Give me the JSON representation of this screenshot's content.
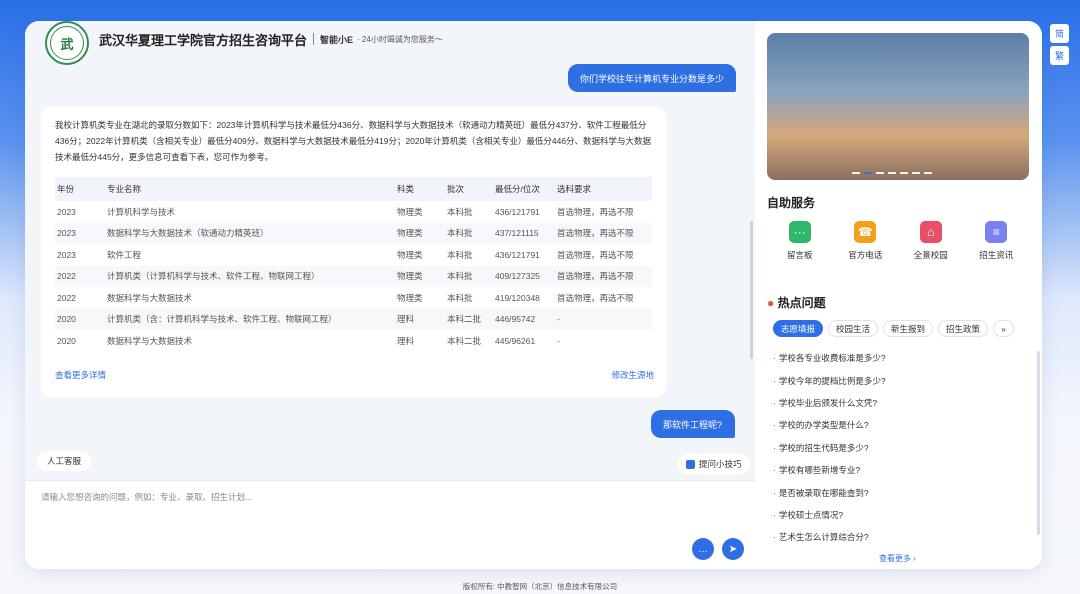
{
  "header": {
    "logo_text": "武",
    "title": "武汉华夏理工学院官方招生咨询平台",
    "assistant_name": "智能小E",
    "slogan": "· 24小时竭诚为您服务～"
  },
  "chat": {
    "user_msg_1": "你们学校往年计算机专业分数是多少",
    "answer_text": "我校计算机类专业在湖北的录取分数如下：2023年计算机科学与技术最低分436分、数据科学与大数据技术（软通动力精英班）最低分437分、软件工程最低分436分；2022年计算机类（含相关专业）最低分409分、数据科学与大数据技术最低分419分；2020年计算机类（含相关专业）最低分446分、数据科学与大数据技术最低分445分，更多信息可查看下表，您可作为参考。",
    "table_headers": [
      "年份",
      "专业名称",
      "科类",
      "批次",
      "最低分/位次",
      "选科要求"
    ],
    "table_rows": [
      [
        "2023",
        "计算机科学与技术",
        "物理类",
        "本科批",
        "436/121791",
        "首选物理，再选不限"
      ],
      [
        "2023",
        "数据科学与大数据技术（软通动力精英班）",
        "物理类",
        "本科批",
        "437/121115",
        "首选物理，再选不限"
      ],
      [
        "2023",
        "软件工程",
        "物理类",
        "本科批",
        "436/121791",
        "首选物理，再选不限"
      ],
      [
        "2022",
        "计算机类（计算机科学与技术、软件工程、物联网工程）",
        "物理类",
        "本科批",
        "409/127325",
        "首选物理，再选不限"
      ],
      [
        "2022",
        "数据科学与大数据技术",
        "物理类",
        "本科批",
        "419/120348",
        "首选物理，再选不限"
      ],
      [
        "2020",
        "计算机类（含：计算机科学与技术、软件工程、物联网工程）",
        "理科",
        "本科二批",
        "446/95742",
        "-"
      ],
      [
        "2020",
        "数据科学与大数据技术",
        "理科",
        "本科二批",
        "445/96261",
        "-"
      ]
    ],
    "link_more": "查看更多详情",
    "link_change_origin": "修改生源地",
    "user_msg_2": "那软件工程呢?"
  },
  "input": {
    "human_service": "人工客服",
    "tips": "提问小技巧",
    "placeholder": "请输入您想咨询的问题，例如：专业、录取、招生计划..."
  },
  "sidebar": {
    "self_service_title": "自助服务",
    "services": [
      {
        "label": "留言板",
        "icon": "message-board-icon",
        "color": "#31b76a",
        "glyph": "···"
      },
      {
        "label": "官方电话",
        "icon": "phone-icon",
        "color": "#f2a21a",
        "glyph": "☎"
      },
      {
        "label": "全景校园",
        "icon": "campus-icon",
        "color": "#e8506a",
        "glyph": "⌂"
      },
      {
        "label": "招生资讯",
        "icon": "news-icon",
        "color": "#7b7ff0",
        "glyph": "≡"
      }
    ],
    "hot_title": "热点问题",
    "hot_tabs": [
      "志愿填报",
      "校园生活",
      "新生报到",
      "招生政策"
    ],
    "hot_questions": [
      "学校各专业收费标准是多少?",
      "学校今年的提档比例是多少?",
      "学校毕业后颁发什么文凭?",
      "学校的办学类型是什么?",
      "学校的招生代码是多少?",
      "学校有哪些新增专业?",
      "是否被录取在哪能查到?",
      "学校硕士点情况?",
      "艺术生怎么计算综合分?"
    ],
    "more_label": "查看更多 ›"
  },
  "lang": {
    "simplified": "简",
    "traditional": "繁"
  },
  "footer": "版权所有: 中教智网（北京）信息技术有限公司",
  "colors": {
    "accent": "#2f6fe4",
    "brand_green": "#2d8f4e"
  }
}
